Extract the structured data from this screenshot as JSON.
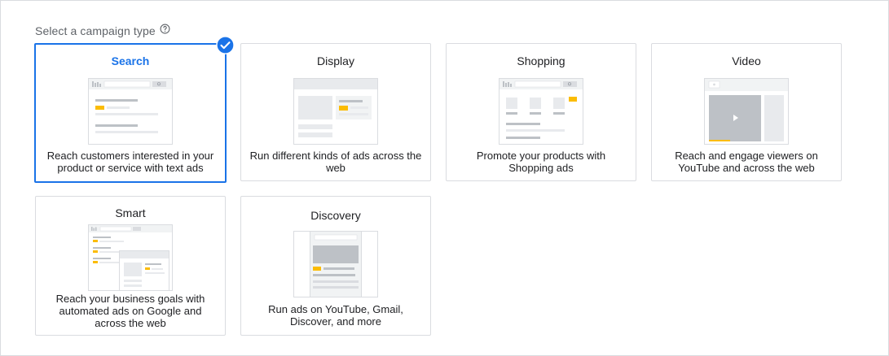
{
  "header": {
    "title": "Select a campaign type",
    "help_icon": "help-circle-icon"
  },
  "campaign_types": [
    {
      "title": "Search",
      "description": "Reach customers interested in your product or service with text ads",
      "selected": true
    },
    {
      "title": "Display",
      "description": "Run different kinds of ads across the web",
      "selected": false
    },
    {
      "title": "Shopping",
      "description": "Promote your products with Shopping ads",
      "selected": false
    },
    {
      "title": "Video",
      "description": "Reach and engage viewers on YouTube and across the web",
      "selected": false
    },
    {
      "title": "Smart",
      "description": "Reach your business goals with automated ads on Google and across the web",
      "selected": false
    },
    {
      "title": "Discovery",
      "description": "Run ads on YouTube, Gmail, Discover, and more",
      "selected": false
    }
  ],
  "selected_check_icon": "check-circle-icon",
  "colors": {
    "accent": "#1a73e8",
    "highlight": "#fbbc04",
    "border": "#dadce0",
    "text": "#202124",
    "muted": "#5f6368"
  }
}
